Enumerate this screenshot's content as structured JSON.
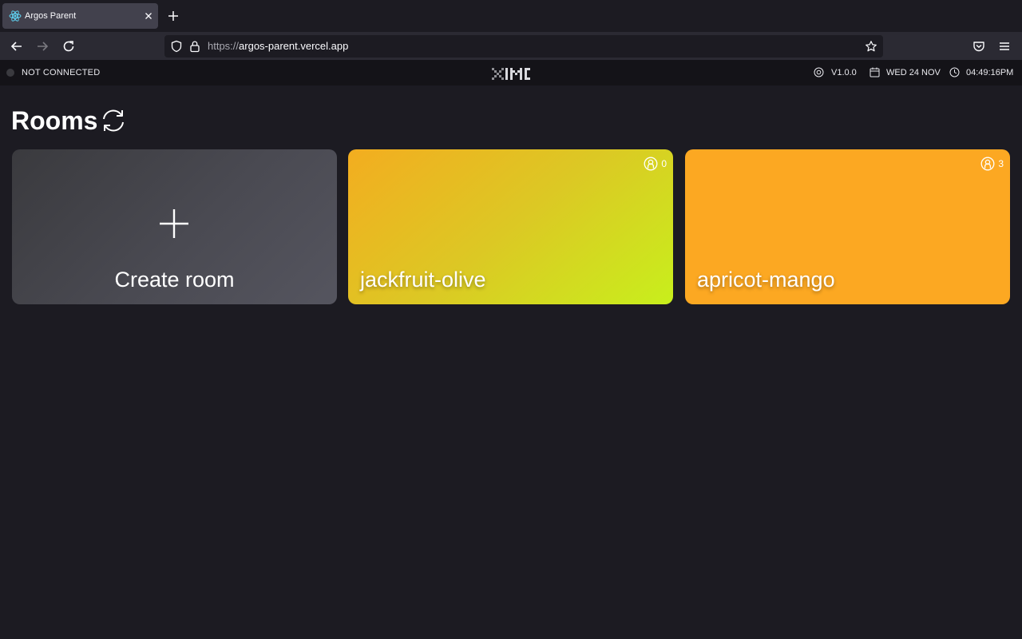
{
  "browser": {
    "tab_title": "Argos Parent",
    "url_protocol": "https://",
    "url_host": "argos-parent.vercel.app"
  },
  "appbar": {
    "connection_status": "NOT CONNECTED",
    "version": "V1.0.0",
    "date": "WED 24 NOV",
    "time": "04:49:16PM",
    "logo_icon": "ximi-logo-icon"
  },
  "page": {
    "title": "Rooms",
    "refresh_icon": "refresh-icon"
  },
  "rooms": {
    "create_label": "Create room",
    "items": [
      {
        "name": "jackfruit-olive",
        "count": "0",
        "colors": [
          "#f3ad20",
          "#c8ef1c"
        ]
      },
      {
        "name": "apricot-mango",
        "count": "3",
        "colors": [
          "#fca822",
          "#fca822"
        ]
      }
    ]
  },
  "colors": {
    "background": "#1c1b22",
    "appbar": "#141318",
    "create_card": "#4a4a52"
  }
}
